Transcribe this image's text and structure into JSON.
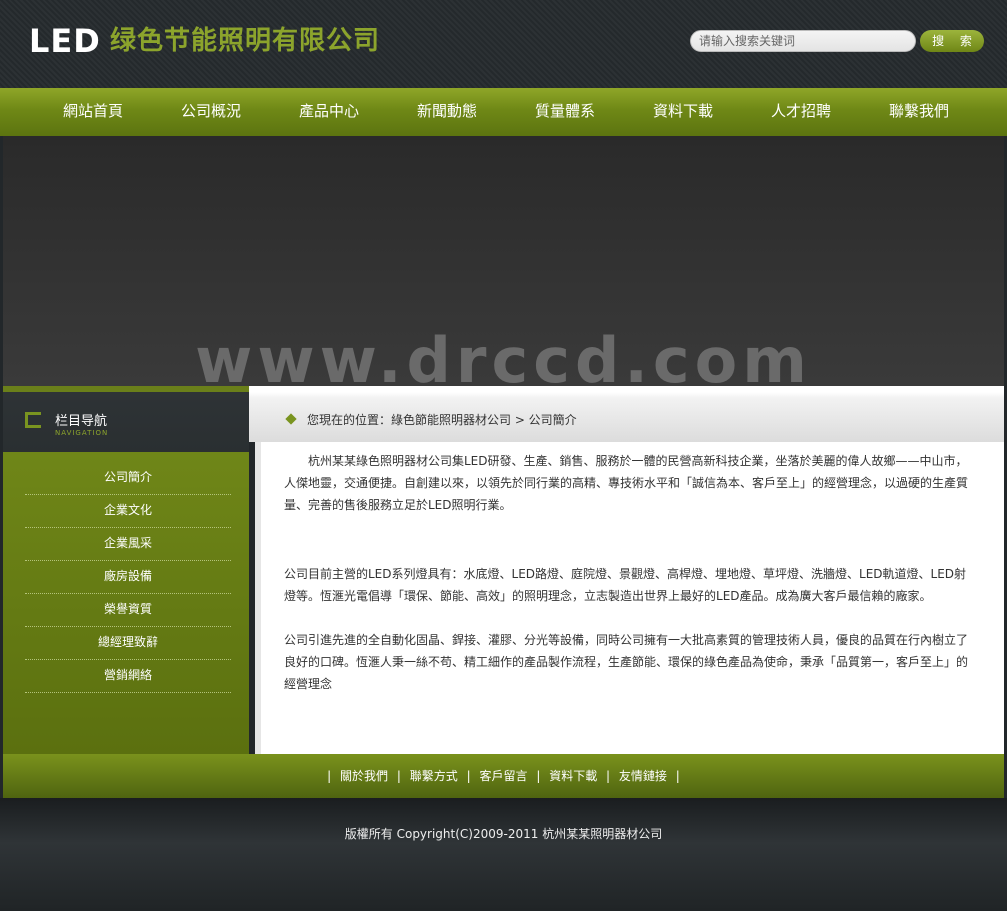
{
  "header": {
    "logo_led": "LED",
    "logo_name": "绿色节能照明有限公司",
    "search_placeholder": "请输入搜索关键词",
    "search_button": "搜 索"
  },
  "nav": [
    {
      "label": "網站首頁"
    },
    {
      "label": "公司概況"
    },
    {
      "label": "產品中心"
    },
    {
      "label": "新聞動態"
    },
    {
      "label": "質量體系"
    },
    {
      "label": "資料下載"
    },
    {
      "label": "人才招聘"
    },
    {
      "label": "聯繫我們"
    }
  ],
  "banner": {
    "watermark": "www.drccd.com"
  },
  "sidebar": {
    "title": "栏目导航",
    "subtitle": "NAVIGATION",
    "items": [
      {
        "label": "公司簡介"
      },
      {
        "label": "企業文化"
      },
      {
        "label": "企業風采"
      },
      {
        "label": "廠房設備"
      },
      {
        "label": "榮譽資質"
      },
      {
        "label": "總經理致辭"
      },
      {
        "label": "營銷網絡"
      }
    ]
  },
  "breadcrumb": {
    "text": "您現在的位置：綠色節能照明器材公司 > 公司簡介"
  },
  "content": {
    "paragraphs": [
      "　　杭州某某綠色照明器材公司集LED研發、生產、銷售、服務於一體的民營高新科技企業，坐落於美麗的偉人故鄉——中山市，人傑地靈，交通便捷。自創建以來，以領先於同行業的高精、專技術水平和「誠信為本、客戶至上」的經營理念，以過硬的生產質量、完善的售後服務立足於LED照明行業。",
      "公司目前主營的LED系列燈具有：水底燈、LED路燈、庭院燈、景觀燈、高桿燈、埋地燈、草坪燈、洗牆燈、LED軌道燈、LED射燈等。恆滙光電倡導「環保、節能、高效」的照明理念，立志製造出世界上最好的LED產品。成為廣大客戶最信賴的廠家。",
      "公司引進先進的全自動化固晶、銲接、灌膠、分光等設備，同時公司擁有一大批高素質的管理技術人員，優良的品質在行內樹立了良好的口碑。恆滙人秉一絲不苟、精工細作的產品製作流程，生產節能、環保的綠色產品為使命，秉承「品質第一，客戶至上」的經營理念"
    ]
  },
  "footer": {
    "links": [
      {
        "label": "關於我們"
      },
      {
        "label": "聯繫方式"
      },
      {
        "label": "客戶留言"
      },
      {
        "label": "資料下載"
      },
      {
        "label": "友情鏈接"
      }
    ],
    "separator": "|",
    "copyright": "版權所有 Copyright(C)2009-2011 杭州某某照明器材公司"
  },
  "colors": {
    "accent_green": "#7a9420",
    "logo_green": "#8ca42c",
    "header_dark": "#2a2f31"
  },
  "icons": {
    "sidebar_icon": "bracket-icon",
    "breadcrumb_icon": "diamond-icon"
  }
}
